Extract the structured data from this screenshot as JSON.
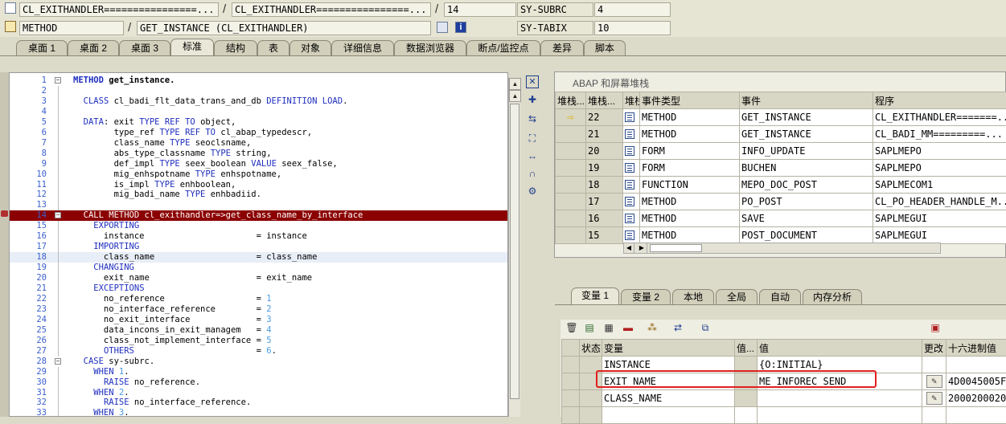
{
  "header": {
    "class_field": "CL_EXITHANDLER================...",
    "class_field2": "CL_EXITHANDLER================...",
    "line_number": "14",
    "subrc_label": "SY-SUBRC",
    "subrc_value": "4",
    "type_field": "METHOD",
    "method_field": "GET_INSTANCE (CL_EXITHANDLER)",
    "tabix_label": "SY-TABIX",
    "tabix_value": "10",
    "info_icon_text": "i"
  },
  "tabs": [
    "桌面 1",
    "桌面 2",
    "桌面 3",
    "标准",
    "结构",
    "表",
    "对象",
    "详细信息",
    "数据浏览器",
    "断点/监控点",
    "差异",
    "脚本"
  ],
  "code": {
    "lines": [
      {
        "n": "1",
        "t": [
          [
            "kw",
            "METHOD"
          ],
          [
            "",
            " get_instance."
          ]
        ],
        "bold": true
      },
      {
        "n": "2",
        "t": []
      },
      {
        "n": "3",
        "t": [
          [
            "",
            "  "
          ],
          [
            "kw",
            "CLASS"
          ],
          [
            "",
            " cl_badi_flt_data_trans_and_db "
          ],
          [
            "kw",
            "DEFINITION LOAD"
          ],
          [
            "",
            "."
          ]
        ]
      },
      {
        "n": "4",
        "t": []
      },
      {
        "n": "5",
        "t": [
          [
            "",
            "  "
          ],
          [
            "kw",
            "DATA"
          ],
          [
            "",
            ": exit "
          ],
          [
            "kw",
            "TYPE REF TO"
          ],
          [
            "",
            " object,"
          ]
        ]
      },
      {
        "n": "6",
        "t": [
          [
            "",
            "        type_ref "
          ],
          [
            "kw",
            "TYPE REF TO"
          ],
          [
            "",
            " cl_abap_typedescr,"
          ]
        ]
      },
      {
        "n": "7",
        "t": [
          [
            "",
            "        class_name "
          ],
          [
            "kw",
            "TYPE"
          ],
          [
            "",
            " seoclsname,"
          ]
        ]
      },
      {
        "n": "8",
        "t": [
          [
            "",
            "        abs_type_classname "
          ],
          [
            "kw",
            "TYPE"
          ],
          [
            "",
            " string,"
          ]
        ]
      },
      {
        "n": "9",
        "t": [
          [
            "",
            "        def_impl "
          ],
          [
            "kw",
            "TYPE"
          ],
          [
            "",
            " seex_boolean "
          ],
          [
            "kw",
            "VALUE"
          ],
          [
            "",
            " seex_false,"
          ]
        ]
      },
      {
        "n": "10",
        "t": [
          [
            "",
            "        mig_enhspotname "
          ],
          [
            "kw",
            "TYPE"
          ],
          [
            "",
            " enhspotname,"
          ]
        ]
      },
      {
        "n": "11",
        "t": [
          [
            "",
            "        is_impl "
          ],
          [
            "kw",
            "TYPE"
          ],
          [
            "",
            " enhboolean,"
          ]
        ]
      },
      {
        "n": "12",
        "t": [
          [
            "",
            "        mig_badi_name "
          ],
          [
            "kw",
            "TYPE"
          ],
          [
            "",
            " enhbadiid."
          ]
        ]
      },
      {
        "n": "13",
        "t": []
      },
      {
        "n": "14",
        "t": [
          [
            "",
            "  "
          ],
          [
            "kw",
            "CALL METHOD"
          ],
          [
            "",
            " cl_exithandler=>get_class_name_by_interface"
          ]
        ],
        "bp": true
      },
      {
        "n": "15",
        "t": [
          [
            "",
            "    "
          ],
          [
            "kw",
            "EXPORTING"
          ]
        ]
      },
      {
        "n": "16",
        "t": [
          [
            "",
            "      instance                      = instance"
          ]
        ]
      },
      {
        "n": "17",
        "t": [
          [
            "",
            "    "
          ],
          [
            "kw",
            "IMPORTING"
          ]
        ]
      },
      {
        "n": "18",
        "t": [
          [
            "",
            "      class_name                    = class_name"
          ]
        ],
        "cur": true
      },
      {
        "n": "19",
        "t": [
          [
            "",
            "    "
          ],
          [
            "kw",
            "CHANGING"
          ]
        ]
      },
      {
        "n": "20",
        "t": [
          [
            "",
            "      exit_name                     = exit_name"
          ]
        ]
      },
      {
        "n": "21",
        "t": [
          [
            "",
            "    "
          ],
          [
            "kw",
            "EXCEPTIONS"
          ]
        ]
      },
      {
        "n": "22",
        "t": [
          [
            "",
            "      no_reference                  = "
          ],
          [
            "num",
            "1"
          ]
        ]
      },
      {
        "n": "23",
        "t": [
          [
            "",
            "      no_interface_reference        = "
          ],
          [
            "num",
            "2"
          ]
        ]
      },
      {
        "n": "24",
        "t": [
          [
            "",
            "      no_exit_interface             = "
          ],
          [
            "num",
            "3"
          ]
        ]
      },
      {
        "n": "25",
        "t": [
          [
            "",
            "      data_incons_in_exit_managem   = "
          ],
          [
            "num",
            "4"
          ]
        ]
      },
      {
        "n": "26",
        "t": [
          [
            "",
            "      class_not_implement_interface = "
          ],
          [
            "num",
            "5"
          ]
        ]
      },
      {
        "n": "27",
        "t": [
          [
            "",
            "      "
          ],
          [
            "kw",
            "OTHERS"
          ],
          [
            "",
            "                        = "
          ],
          [
            "num",
            "6"
          ],
          [
            "",
            "."
          ]
        ]
      },
      {
        "n": "28",
        "t": [
          [
            "",
            "  "
          ],
          [
            "kw",
            "CASE"
          ],
          [
            "",
            " sy-subrc."
          ]
        ]
      },
      {
        "n": "29",
        "t": [
          [
            "",
            "    "
          ],
          [
            "kw",
            "WHEN"
          ],
          [
            "",
            " "
          ],
          [
            "num",
            "1"
          ],
          [
            "",
            "."
          ]
        ]
      },
      {
        "n": "30",
        "t": [
          [
            "",
            "      "
          ],
          [
            "kw",
            "RAISE"
          ],
          [
            "",
            " no_reference."
          ]
        ]
      },
      {
        "n": "31",
        "t": [
          [
            "",
            "    "
          ],
          [
            "kw",
            "WHEN"
          ],
          [
            "",
            " "
          ],
          [
            "num",
            "2"
          ],
          [
            "",
            "."
          ]
        ]
      },
      {
        "n": "32",
        "t": [
          [
            "",
            "      "
          ],
          [
            "kw",
            "RAISE"
          ],
          [
            "",
            " no_interface_reference."
          ]
        ]
      },
      {
        "n": "33",
        "t": [
          [
            "",
            "    "
          ],
          [
            "kw",
            "WHEN"
          ],
          [
            "",
            " "
          ],
          [
            "num",
            "3"
          ],
          [
            "",
            "."
          ]
        ]
      }
    ]
  },
  "stack": {
    "title": "ABAP 和屏幕堆栈",
    "columns": [
      "堆栈...",
      "堆栈...",
      "堆栈",
      "事件类型",
      "事件",
      "程序"
    ],
    "rows": [
      {
        "level": "22",
        "type": "METHOD",
        "event": "GET_INSTANCE",
        "program": "CL_EXITHANDLER=======...",
        "current": true
      },
      {
        "level": "21",
        "type": "METHOD",
        "event": "GET_INSTANCE",
        "program": "CL_BADI_MM=========..."
      },
      {
        "level": "20",
        "type": "FORM",
        "event": "INFO_UPDATE",
        "program": "SAPLMEPO"
      },
      {
        "level": "19",
        "type": "FORM",
        "event": "BUCHEN",
        "program": "SAPLMEPO"
      },
      {
        "level": "18",
        "type": "FUNCTION",
        "event": "MEPO_DOC_POST",
        "program": "SAPLMECOM1"
      },
      {
        "level": "17",
        "type": "METHOD",
        "event": "PO_POST",
        "program": "CL_PO_HEADER_HANDLE_M..."
      },
      {
        "level": "16",
        "type": "METHOD",
        "event": "SAVE",
        "program": "SAPLMEGUI"
      },
      {
        "level": "15",
        "type": "METHOD",
        "event": "POST_DOCUMENT",
        "program": "SAPLMEGUI"
      }
    ]
  },
  "var_tabs": [
    "变量 1",
    "变量 2",
    "本地",
    "全局",
    "自动",
    "内存分析"
  ],
  "vars": {
    "columns": [
      "状态",
      "变量",
      "值...",
      "值",
      "更改",
      "十六进制值"
    ],
    "rows": [
      {
        "name": "INSTANCE",
        "value": "{O:INITIAL}",
        "hex": ""
      },
      {
        "name": "EXIT_NAME",
        "value": "ME_INFOREC_SEND",
        "hex": "4D0045005F"
      },
      {
        "name": "CLASS_NAME",
        "value": "",
        "hex": "2000200020"
      }
    ]
  },
  "colors": {
    "breakpoint_line": "#8b0000",
    "highlight_box": "#e02020",
    "keyword": "#1f2fbf",
    "line_number": "#3a5fcd"
  }
}
